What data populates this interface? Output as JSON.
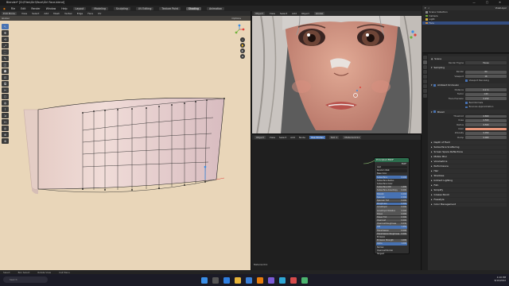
{
  "window": {
    "title": "Blender* [D:\\Files\\Girl\\Face\\Girl Face.blend]",
    "controls": [
      "—",
      "▢",
      "✕"
    ]
  },
  "menu": {
    "items": [
      "File",
      "Edit",
      "Render",
      "Window",
      "Help"
    ],
    "workspaces": [
      "Layout",
      "Modeling",
      "Sculpting",
      "UV Editing",
      "Texture Paint",
      "Shading",
      "Animation"
    ],
    "active_workspace": "Shading"
  },
  "left_viewport": {
    "header": [
      "Edit Mode",
      "View",
      "Select",
      "Add",
      "Mesh",
      "Vertex",
      "Edge",
      "Face",
      "UV"
    ],
    "header2": [
      "Global",
      "Options"
    ],
    "tools": [
      "↖",
      "✥",
      "⟲",
      "⤢",
      "⬚",
      "✎",
      "◫",
      "⬟",
      "⊡",
      "⧉",
      "✂",
      "⬡",
      "◍",
      "⌇",
      "⇲",
      "↔",
      "◎",
      "⊕",
      "⊗"
    ],
    "nav_buttons": [
      "+",
      "✋",
      "◐",
      "⊞"
    ]
  },
  "right_viewport": {
    "header": [
      "Object",
      "View",
      "Select",
      "Add",
      "Object",
      "Global"
    ]
  },
  "node_editor": {
    "header": [
      "Object",
      "View",
      "Select",
      "Add",
      "Node",
      "Use Nodes",
      "Slot 1",
      "Material.011"
    ],
    "node": {
      "title": "Principled BSDF",
      "output": "BSDF",
      "rows": [
        {
          "label": "GGX",
          "value": ""
        },
        {
          "label": "Random Walk",
          "value": ""
        },
        {
          "label": "Base Color",
          "value": ""
        },
        {
          "label": "Subsurface",
          "value": "0.000"
        },
        {
          "label": "Subsurface Radius",
          "value": ""
        },
        {
          "label": "Subsurface Color",
          "value": ""
        },
        {
          "label": "Subsurface IOR",
          "value": "1.400"
        },
        {
          "label": "Subsurface Anisotropy",
          "value": "0.000"
        },
        {
          "label": "Metallic",
          "value": "0.000"
        },
        {
          "label": "Specular",
          "value": "0.500"
        },
        {
          "label": "Specular Tint",
          "value": "0.000"
        },
        {
          "label": "Roughness",
          "value": "0.500"
        },
        {
          "label": "Anisotropic",
          "value": "0.000"
        },
        {
          "label": "Anisotropic Rotation",
          "value": "0.000"
        },
        {
          "label": "Sheen",
          "value": "0.000"
        },
        {
          "label": "Sheen Tint",
          "value": "0.500"
        },
        {
          "label": "Clearcoat",
          "value": "0.000"
        },
        {
          "label": "Clearcoat Roughness",
          "value": "0.030"
        },
        {
          "label": "IOR",
          "value": "1.450"
        },
        {
          "label": "Transmission",
          "value": "0.000"
        },
        {
          "label": "Transmission Roughness",
          "value": "0.000"
        },
        {
          "label": "Emission",
          "value": ""
        },
        {
          "label": "Emission Strength",
          "value": "1.000"
        },
        {
          "label": "Alpha",
          "value": "1.000"
        },
        {
          "label": "Normal",
          "value": ""
        },
        {
          "label": "Clearcoat Normal",
          "value": ""
        },
        {
          "label": "Tangent",
          "value": ""
        }
      ]
    },
    "footer": "Material.011"
  },
  "outliner": {
    "title": "Scene Collection",
    "items": [
      "Scene Collection",
      "Camera",
      "Light",
      "Face"
    ],
    "right_label": "ViewLayer"
  },
  "properties": {
    "scene_label": "Scene",
    "render_engine_label": "Render Engine",
    "render_engine": "Eevee",
    "sampling_section": "Sampling",
    "sampling": [
      {
        "label": "Render",
        "value": "64"
      },
      {
        "label": "Viewport",
        "value": "16"
      }
    ],
    "viewport_denoising": "Viewport Denoising",
    "ao_section": "Ambient Occlusion",
    "ao_rows": [
      {
        "label": "Distance",
        "value": "0.2 m"
      },
      {
        "label": "Factor",
        "value": "1.00"
      },
      {
        "label": "Trace Precision",
        "value": "0.250"
      }
    ],
    "ao_checks": [
      "Bent Normals",
      "Bounces Approximation"
    ],
    "bloom_section": "Bloom",
    "bloom_rows": [
      {
        "label": "Threshold",
        "value": "0.800"
      },
      {
        "label": "Knee",
        "value": "0.500"
      },
      {
        "label": "Radius",
        "value": "6.500"
      },
      {
        "label": "Color",
        "value": ""
      },
      {
        "label": "Intensity",
        "value": "0.050"
      },
      {
        "label": "Clamp",
        "value": "0.000"
      }
    ],
    "collapsed_sections": [
      "Depth of Field",
      "Subsurface Scattering",
      "Screen Space Reflections",
      "Motion Blur",
      "Volumetrics",
      "Performance",
      "Hair",
      "Shadows",
      "Indirect Lighting",
      "Film",
      "Simplify",
      "Grease Pencil",
      "Freestyle",
      "Color Management"
    ]
  },
  "status_bar": [
    "Select",
    "Box Select",
    "Rotate View",
    "Call Menu"
  ],
  "taskbar": {
    "search_placeholder": "Search",
    "time": "4:10 PM",
    "date": "8/10/2022"
  },
  "colors": {
    "accent": "#4772b3",
    "viewport_bg": "#e9d6b9",
    "bloom_color": "#e7967a"
  }
}
